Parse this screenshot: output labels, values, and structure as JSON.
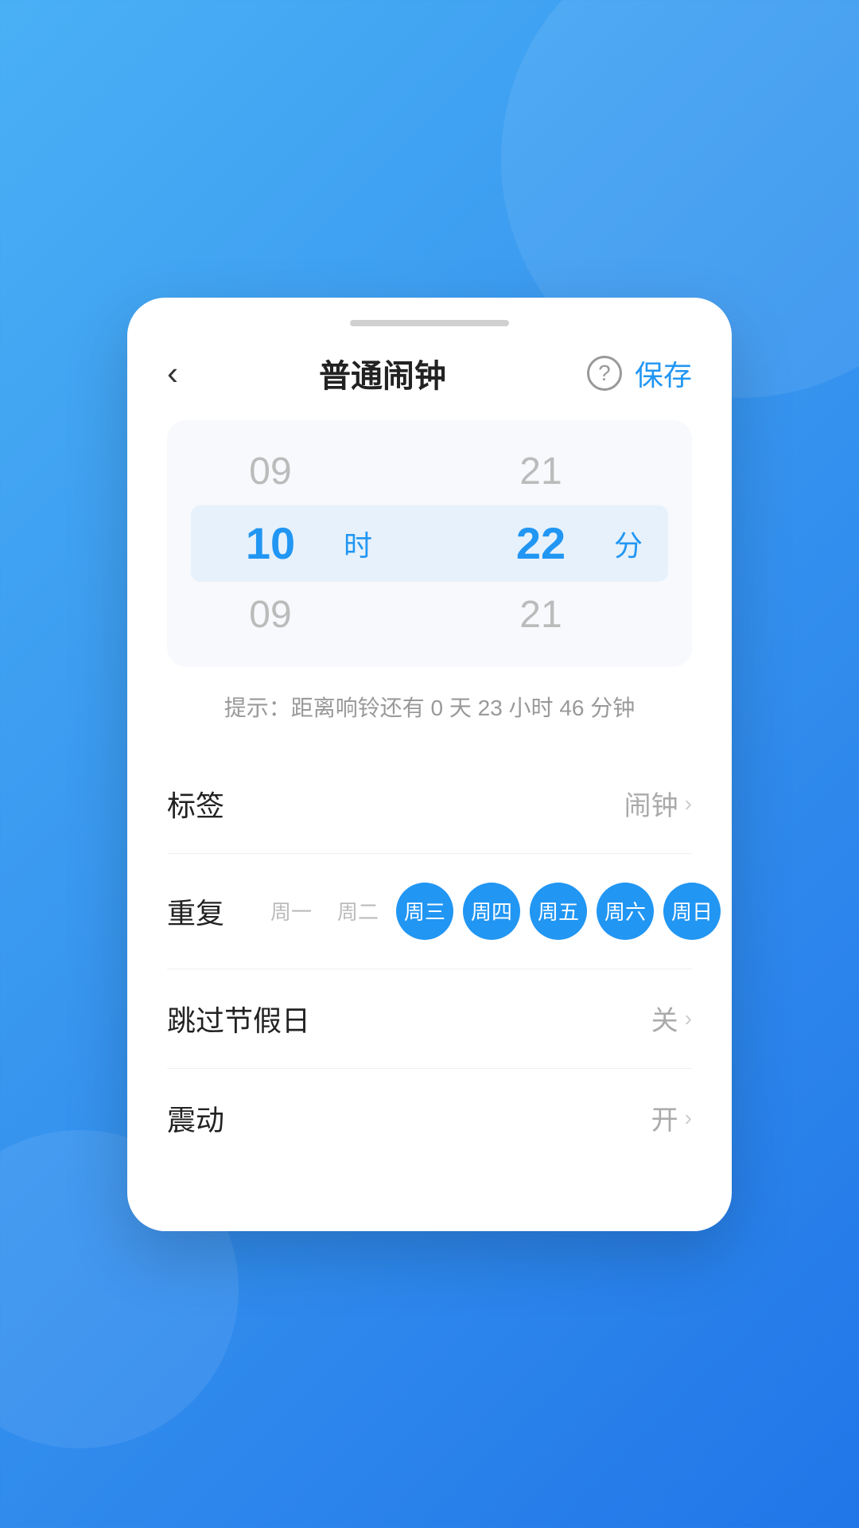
{
  "background": {
    "color_start": "#4ab0f5",
    "color_end": "#2176e8"
  },
  "header": {
    "back_label": "‹",
    "title": "普通闹钟",
    "help_icon": "?",
    "save_label": "保存"
  },
  "time_picker": {
    "hour_prev": "09",
    "hour_current": "10",
    "hour_label": "时",
    "hour_next": "09",
    "minute_prev": "21",
    "minute_current": "22",
    "minute_label": "分",
    "minute_next": "21"
  },
  "hint": {
    "text": "提示：距离响铃还有 0 天 23 小时 46 分钟"
  },
  "settings": {
    "label_label": "标签",
    "label_value": "闹钟",
    "repeat_label": "重复",
    "days": [
      {
        "name": "周一",
        "active": false
      },
      {
        "name": "周二",
        "active": false
      },
      {
        "name": "周三",
        "active": true
      },
      {
        "name": "周四",
        "active": true
      },
      {
        "name": "周五",
        "active": true
      },
      {
        "name": "周六",
        "active": true
      },
      {
        "name": "周日",
        "active": true
      }
    ],
    "holiday_label": "跳过节假日",
    "holiday_value": "关",
    "vibrate_label": "震动",
    "vibrate_value": "开"
  }
}
